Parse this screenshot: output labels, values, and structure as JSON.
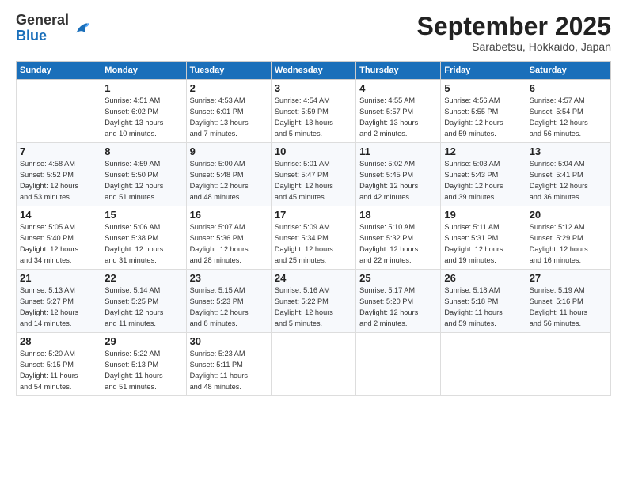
{
  "header": {
    "logo": {
      "general": "General",
      "blue": "Blue"
    },
    "title": "September 2025",
    "subtitle": "Sarabetsu, Hokkaido, Japan"
  },
  "weekdays": [
    "Sunday",
    "Monday",
    "Tuesday",
    "Wednesday",
    "Thursday",
    "Friday",
    "Saturday"
  ],
  "weeks": [
    [
      {
        "day": "",
        "info": ""
      },
      {
        "day": "1",
        "info": "Sunrise: 4:51 AM\nSunset: 6:02 PM\nDaylight: 13 hours\nand 10 minutes."
      },
      {
        "day": "2",
        "info": "Sunrise: 4:53 AM\nSunset: 6:01 PM\nDaylight: 13 hours\nand 7 minutes."
      },
      {
        "day": "3",
        "info": "Sunrise: 4:54 AM\nSunset: 5:59 PM\nDaylight: 13 hours\nand 5 minutes."
      },
      {
        "day": "4",
        "info": "Sunrise: 4:55 AM\nSunset: 5:57 PM\nDaylight: 13 hours\nand 2 minutes."
      },
      {
        "day": "5",
        "info": "Sunrise: 4:56 AM\nSunset: 5:55 PM\nDaylight: 12 hours\nand 59 minutes."
      },
      {
        "day": "6",
        "info": "Sunrise: 4:57 AM\nSunset: 5:54 PM\nDaylight: 12 hours\nand 56 minutes."
      }
    ],
    [
      {
        "day": "7",
        "info": "Sunrise: 4:58 AM\nSunset: 5:52 PM\nDaylight: 12 hours\nand 53 minutes."
      },
      {
        "day": "8",
        "info": "Sunrise: 4:59 AM\nSunset: 5:50 PM\nDaylight: 12 hours\nand 51 minutes."
      },
      {
        "day": "9",
        "info": "Sunrise: 5:00 AM\nSunset: 5:48 PM\nDaylight: 12 hours\nand 48 minutes."
      },
      {
        "day": "10",
        "info": "Sunrise: 5:01 AM\nSunset: 5:47 PM\nDaylight: 12 hours\nand 45 minutes."
      },
      {
        "day": "11",
        "info": "Sunrise: 5:02 AM\nSunset: 5:45 PM\nDaylight: 12 hours\nand 42 minutes."
      },
      {
        "day": "12",
        "info": "Sunrise: 5:03 AM\nSunset: 5:43 PM\nDaylight: 12 hours\nand 39 minutes."
      },
      {
        "day": "13",
        "info": "Sunrise: 5:04 AM\nSunset: 5:41 PM\nDaylight: 12 hours\nand 36 minutes."
      }
    ],
    [
      {
        "day": "14",
        "info": "Sunrise: 5:05 AM\nSunset: 5:40 PM\nDaylight: 12 hours\nand 34 minutes."
      },
      {
        "day": "15",
        "info": "Sunrise: 5:06 AM\nSunset: 5:38 PM\nDaylight: 12 hours\nand 31 minutes."
      },
      {
        "day": "16",
        "info": "Sunrise: 5:07 AM\nSunset: 5:36 PM\nDaylight: 12 hours\nand 28 minutes."
      },
      {
        "day": "17",
        "info": "Sunrise: 5:09 AM\nSunset: 5:34 PM\nDaylight: 12 hours\nand 25 minutes."
      },
      {
        "day": "18",
        "info": "Sunrise: 5:10 AM\nSunset: 5:32 PM\nDaylight: 12 hours\nand 22 minutes."
      },
      {
        "day": "19",
        "info": "Sunrise: 5:11 AM\nSunset: 5:31 PM\nDaylight: 12 hours\nand 19 minutes."
      },
      {
        "day": "20",
        "info": "Sunrise: 5:12 AM\nSunset: 5:29 PM\nDaylight: 12 hours\nand 16 minutes."
      }
    ],
    [
      {
        "day": "21",
        "info": "Sunrise: 5:13 AM\nSunset: 5:27 PM\nDaylight: 12 hours\nand 14 minutes."
      },
      {
        "day": "22",
        "info": "Sunrise: 5:14 AM\nSunset: 5:25 PM\nDaylight: 12 hours\nand 11 minutes."
      },
      {
        "day": "23",
        "info": "Sunrise: 5:15 AM\nSunset: 5:23 PM\nDaylight: 12 hours\nand 8 minutes."
      },
      {
        "day": "24",
        "info": "Sunrise: 5:16 AM\nSunset: 5:22 PM\nDaylight: 12 hours\nand 5 minutes."
      },
      {
        "day": "25",
        "info": "Sunrise: 5:17 AM\nSunset: 5:20 PM\nDaylight: 12 hours\nand 2 minutes."
      },
      {
        "day": "26",
        "info": "Sunrise: 5:18 AM\nSunset: 5:18 PM\nDaylight: 11 hours\nand 59 minutes."
      },
      {
        "day": "27",
        "info": "Sunrise: 5:19 AM\nSunset: 5:16 PM\nDaylight: 11 hours\nand 56 minutes."
      }
    ],
    [
      {
        "day": "28",
        "info": "Sunrise: 5:20 AM\nSunset: 5:15 PM\nDaylight: 11 hours\nand 54 minutes."
      },
      {
        "day": "29",
        "info": "Sunrise: 5:22 AM\nSunset: 5:13 PM\nDaylight: 11 hours\nand 51 minutes."
      },
      {
        "day": "30",
        "info": "Sunrise: 5:23 AM\nSunset: 5:11 PM\nDaylight: 11 hours\nand 48 minutes."
      },
      {
        "day": "",
        "info": ""
      },
      {
        "day": "",
        "info": ""
      },
      {
        "day": "",
        "info": ""
      },
      {
        "day": "",
        "info": ""
      }
    ]
  ]
}
